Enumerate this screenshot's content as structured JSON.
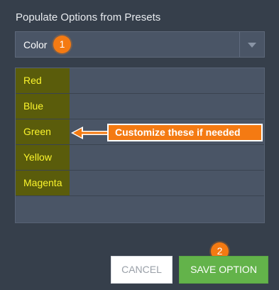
{
  "dialog": {
    "heading": "Populate Options from Presets"
  },
  "preset_select": {
    "value": "Color",
    "arrow_icon": "triangle-down-icon"
  },
  "options": [
    {
      "label": "Red"
    },
    {
      "label": "Blue"
    },
    {
      "label": "Green"
    },
    {
      "label": "Yellow"
    },
    {
      "label": "Magenta"
    }
  ],
  "callout": {
    "text": "Customize these if needed"
  },
  "badges": {
    "one": "1",
    "two": "2"
  },
  "buttons": {
    "cancel_label": "CANCEL",
    "save_label": "SAVE OPTION"
  },
  "colors": {
    "background": "#363f4b",
    "accent_orange": "#f47a12",
    "option_label_bg": "#5a5c0b",
    "option_label_text": "#fbf52c",
    "save_green": "#63b34a"
  }
}
